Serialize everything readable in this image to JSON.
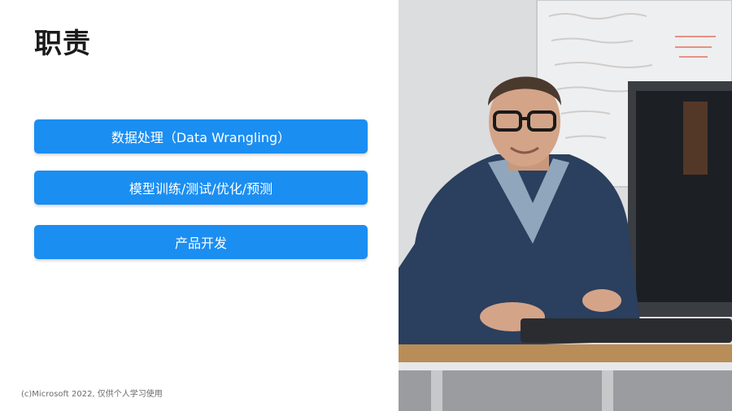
{
  "slide": {
    "title": "职责",
    "items": [
      {
        "label": "数据处理（Data Wrangling）"
      },
      {
        "label": "模型训练/测试/优化/预测"
      },
      {
        "label": "产品开发"
      }
    ],
    "footer": "(c)Microsoft 2022, 仅供个人学习使用"
  },
  "photo": {
    "subject": "person-at-desk-photo",
    "colors": {
      "accent_button": "#1b8ef2",
      "jacket": "#2b3f5e",
      "shirt": "#8fa6bd",
      "desk": "#b98d58"
    }
  }
}
